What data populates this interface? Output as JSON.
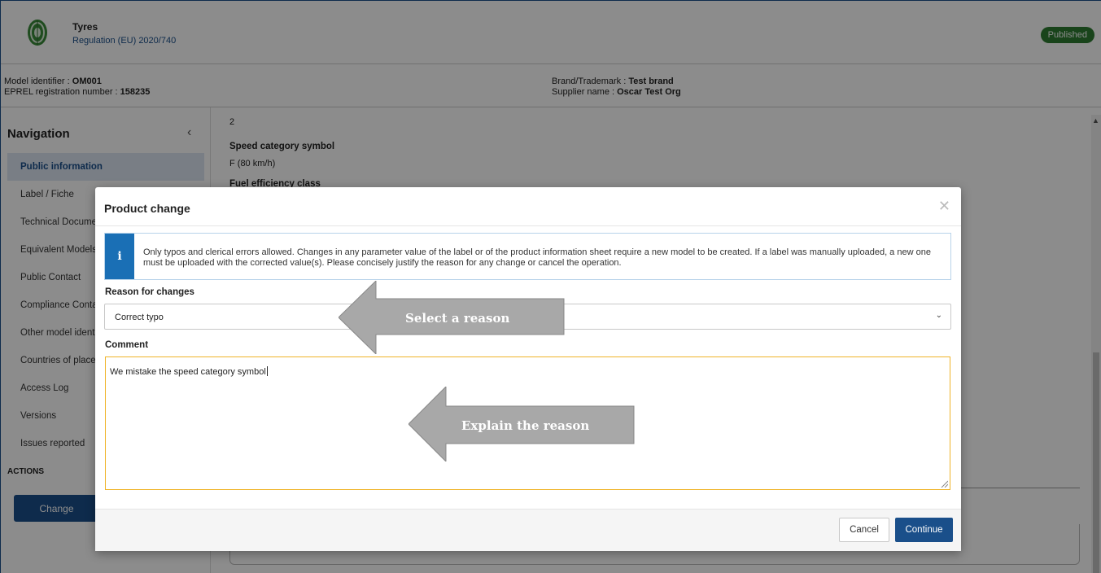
{
  "header": {
    "title": "Tyres",
    "regulation": "Regulation (EU) 2020/740",
    "status": "Published"
  },
  "info": {
    "model_identifier_label": "Model identifier : ",
    "model_identifier": "OM001",
    "eprel_label": "EPREL registration number : ",
    "eprel_number": "158235",
    "brand_label": "Brand/Trademark : ",
    "brand": "Test brand",
    "supplier_label": "Supplier name : ",
    "supplier": "Oscar Test Org"
  },
  "sidebar": {
    "title": "Navigation",
    "collapse_icon": "chevron-left-icon",
    "items": [
      {
        "label": "Public information"
      },
      {
        "label": "Label / Fiche"
      },
      {
        "label": "Technical Documentation"
      },
      {
        "label": "Equivalent Models"
      },
      {
        "label": "Public Contact"
      },
      {
        "label": "Compliance Contact"
      },
      {
        "label": "Other model identifiers"
      },
      {
        "label": "Countries of placement"
      },
      {
        "label": "Access Log"
      },
      {
        "label": "Versions"
      },
      {
        "label": "Issues reported"
      }
    ],
    "actions_title": "ACTIONS",
    "change_button": "Change"
  },
  "content": {
    "value_top": "2",
    "speed_label": "Speed category symbol",
    "speed_value": "F (80 km/h)",
    "fuel_label": "Fuel efficiency class"
  },
  "modal": {
    "title": "Product change",
    "close_icon": "close-icon",
    "alert_icon": "info-icon",
    "alert_text": "Only typos and clerical errors allowed. Changes in any parameter value of the label or of the product information sheet require a new model to be created. If a label was manually uploaded, a new one must be uploaded with the corrected value(s). Please concisely justify the reason for any change or cancel the operation.",
    "reason_label": "Reason for changes",
    "reason_value": "Correct typo",
    "comment_label": "Comment",
    "comment_value": "We mistake the speed category symbol",
    "cancel_button": "Cancel",
    "continue_button": "Continue"
  },
  "annotations": {
    "arrow1": "Select a reason",
    "arrow2": "Explain the reason"
  },
  "colors": {
    "primary": "#1a4f8a",
    "published": "#2e7d32",
    "info": "#1a6fb5",
    "focus_border": "#f0b429",
    "annotation_arrow": "#a8a8a8"
  }
}
